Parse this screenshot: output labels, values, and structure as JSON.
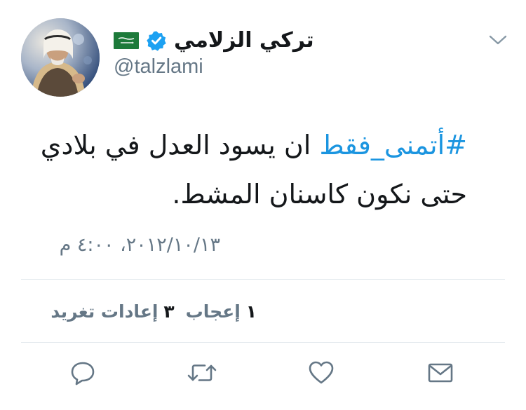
{
  "tweet": {
    "user": {
      "display_name": "تركي الزلامي",
      "handle": "@talzlami",
      "flag_icon": "saudi-flag-icon",
      "verified_icon": "verified-badge-icon"
    },
    "text": {
      "hashtag": "#أتمنى_فقط",
      "line1_rest": " ان يسود العدل في بلادي",
      "line2": "حتى نكون كاسنان المشط."
    },
    "timestamp": "٢٠١٢/١٠/١٣، ٤:٠٠ م",
    "stats": {
      "likes_count": "١",
      "likes_label": "إعجاب",
      "retweets_count": "٣",
      "retweets_label": "إعادات تغريد"
    },
    "actions": {
      "reply_icon": "reply-icon",
      "retweet_icon": "retweet-icon",
      "like_icon": "heart-icon",
      "message_icon": "envelope-icon"
    }
  },
  "colors": {
    "link": "#1b95e0",
    "text": "#14171a",
    "secondary": "#657786",
    "divider": "#e1e8ed",
    "icon": "#657786"
  }
}
